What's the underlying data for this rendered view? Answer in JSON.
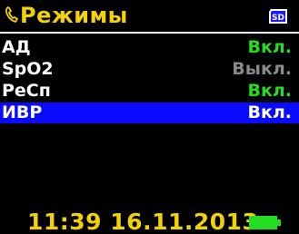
{
  "header": {
    "title": "Режимы",
    "phone_icon": "phone-handset-icon",
    "sd_icon": "sd-card-icon",
    "sd_label": "SD",
    "title_color": "#f2d200"
  },
  "modes": [
    {
      "name": "АД",
      "state": "Вкл.",
      "state_color": "#22dd22",
      "selected": false
    },
    {
      "name": "SpO2",
      "state": "Выкл.",
      "state_color": "#8a8a8a",
      "selected": false
    },
    {
      "name": "РеСп",
      "state": "Вкл.",
      "state_color": "#22dd22",
      "selected": false
    },
    {
      "name": "ИВР",
      "state": "Вкл.",
      "state_color": "#ffffff",
      "selected": true
    }
  ],
  "status": {
    "datetime": "11:39 16.11.2013",
    "battery_icon": "battery-full-icon",
    "battery_color": "#22dd22",
    "selection_color": "#0a0aff"
  }
}
